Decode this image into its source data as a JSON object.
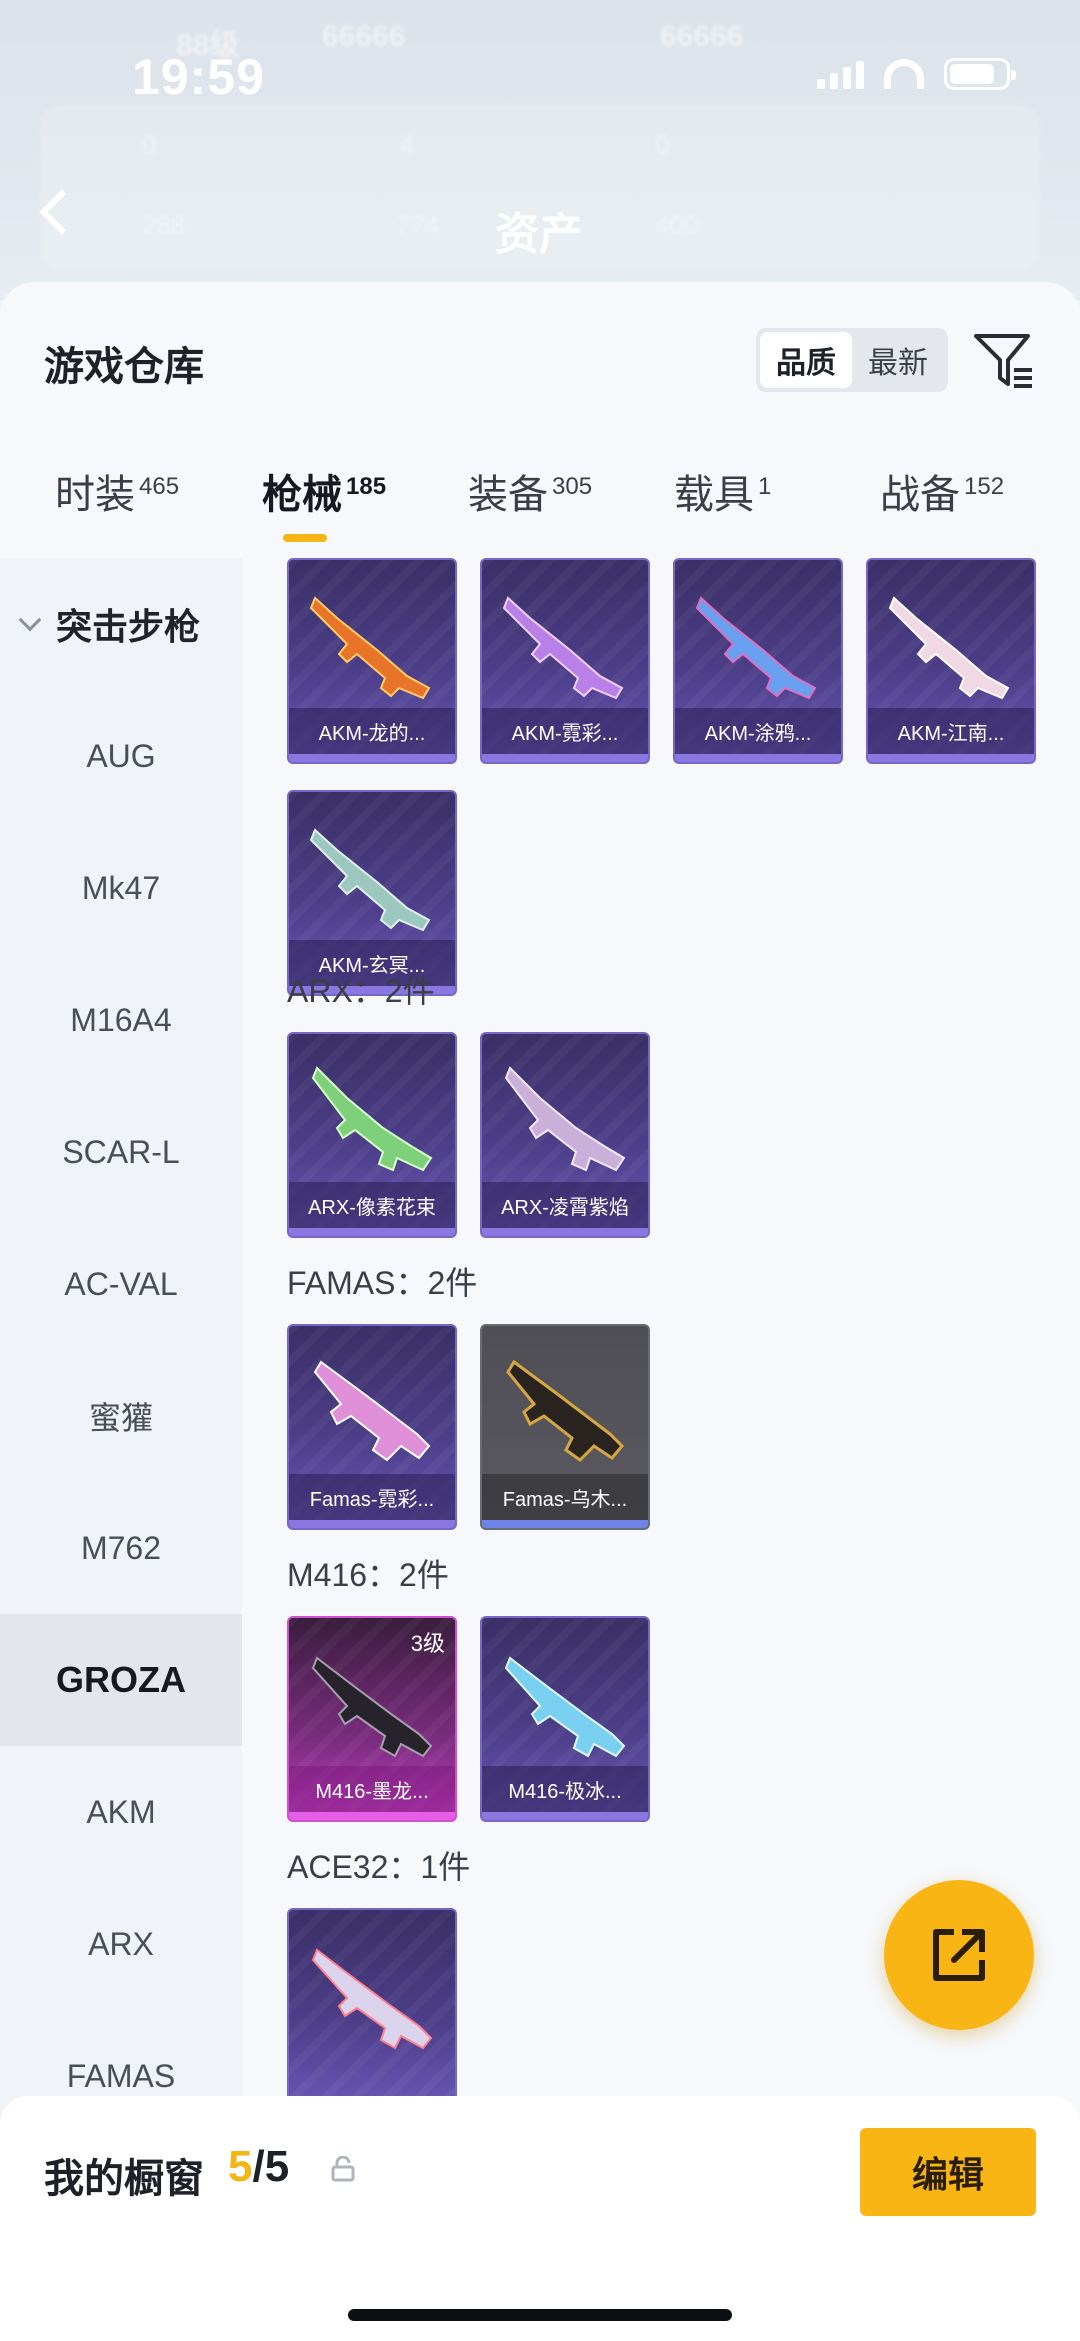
{
  "status_bar": {
    "time": "19:59"
  },
  "background": {
    "level_text": "88级",
    "coin_text": "66666",
    "gold_text": "66666",
    "stats_row1": [
      "0",
      "4",
      "0"
    ],
    "stats_row2": [
      "288",
      "774",
      "400"
    ],
    "title": "资产"
  },
  "sheet": {
    "title": "游戏仓库",
    "sort": {
      "options": [
        "品质",
        "最新"
      ],
      "selected": "品质"
    },
    "filter_icon": "filter-icon"
  },
  "tabs": [
    {
      "label": "时装",
      "count": "465"
    },
    {
      "label": "枪械",
      "count": "185",
      "active": true
    },
    {
      "label": "装备",
      "count": "305"
    },
    {
      "label": "载具",
      "count": "1"
    },
    {
      "label": "战备",
      "count": "152"
    }
  ],
  "sidebar": {
    "header": "突击步枪",
    "items": [
      "AUG",
      "Mk47",
      "M16A4",
      "SCAR-L",
      "AC-VAL",
      "蜜獾",
      "M762",
      "GROZA",
      "AKM",
      "ARX",
      "FAMAS"
    ],
    "selected": "GROZA"
  },
  "groups": {
    "akm_cards": [
      "AKM-龙的...",
      "AKM-霓彩...",
      "AKM-涂鸦...",
      "AKM-江南...",
      "AKM-玄冥..."
    ],
    "arx": {
      "label": "ARX：2件",
      "cards": [
        "ARX-像素花束",
        "ARX-凌霄紫焰"
      ]
    },
    "famas": {
      "label": "FAMAS：2件",
      "cards": [
        "Famas-霓彩...",
        "Famas-乌木..."
      ]
    },
    "m416": {
      "label": "M416：2件",
      "cards": [
        "M416-墨龙...",
        "M416-极冰..."
      ],
      "level_badge": "3级"
    },
    "ace32": {
      "label": "ACE32：1件"
    }
  },
  "bottom_bar": {
    "label": "我的橱窗",
    "current": "5",
    "total": "/5",
    "edit_label": "编辑"
  },
  "colors": {
    "accent": "#f8b514",
    "card_purple": "#4c3e88",
    "card_pink": "#c040c0"
  }
}
